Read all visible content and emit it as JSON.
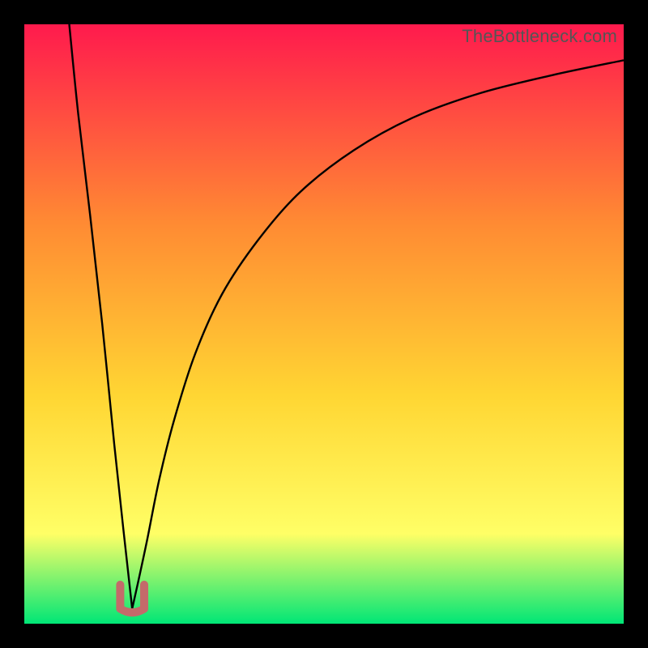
{
  "watermark": "TheBottleneck.com",
  "chart_data": {
    "type": "line",
    "title": "",
    "xlabel": "",
    "ylabel": "",
    "xlim": [
      0,
      100
    ],
    "ylim": [
      0,
      100
    ],
    "grid": false,
    "legend": false,
    "background_gradient": {
      "top_color": "#ff1a4d",
      "mid_colors": [
        "#ff8a33",
        "#ffd633",
        "#ffff66"
      ],
      "bottom_color": "#00e676"
    },
    "notch_marker": {
      "x": 18,
      "y": 2.5,
      "color": "#c46a6a",
      "shape": "u-notch",
      "width": 4,
      "height": 5
    },
    "series": [
      {
        "name": "left-branch",
        "description": "steep descending curve from top-left into the notch",
        "x": [
          7.5,
          9,
          11,
          13,
          15,
          16.5,
          17.5,
          18
        ],
        "y": [
          100,
          85,
          68,
          50,
          30,
          16,
          7,
          2.5
        ]
      },
      {
        "name": "right-branch",
        "description": "ascending curve from the notch toward the upper right, flattening",
        "x": [
          18,
          19,
          20.5,
          22.5,
          25,
          28.5,
          33,
          39,
          46,
          55,
          65,
          76,
          88,
          100
        ],
        "y": [
          2.5,
          7,
          14,
          24,
          34,
          45,
          55,
          64,
          72,
          79,
          84.5,
          88.5,
          91.5,
          94
        ]
      }
    ]
  }
}
